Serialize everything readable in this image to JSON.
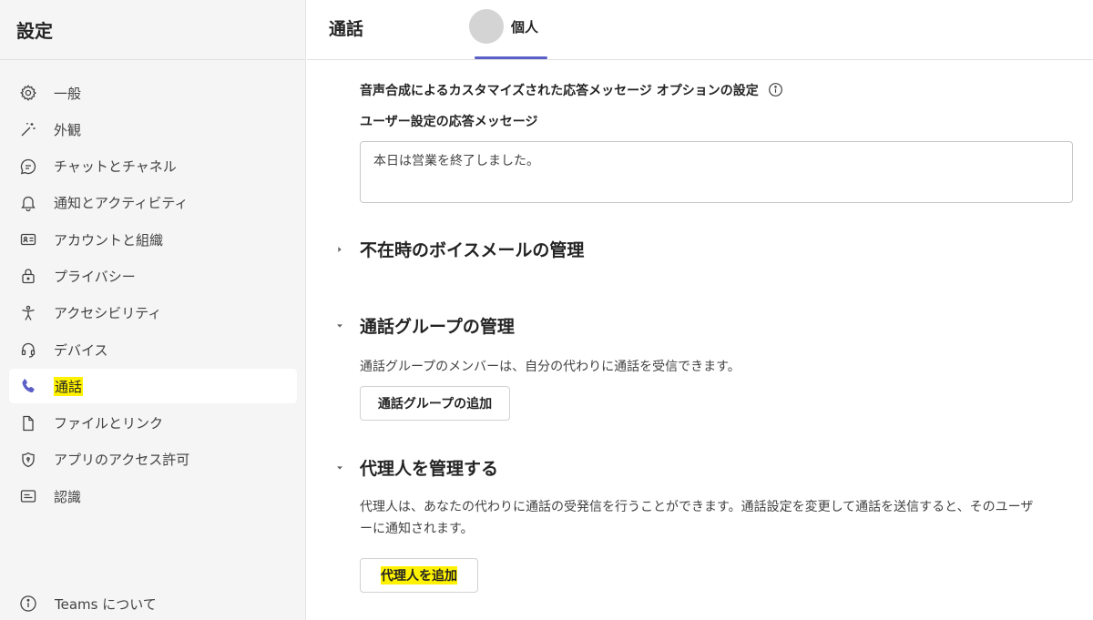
{
  "sidebar": {
    "title": "設定",
    "items": [
      {
        "label": "一般",
        "icon": "gear-icon"
      },
      {
        "label": "外観",
        "icon": "magic-wand-icon"
      },
      {
        "label": "チャットとチャネル",
        "icon": "chat-icon"
      },
      {
        "label": "通知とアクティビティ",
        "icon": "bell-icon"
      },
      {
        "label": "アカウントと組織",
        "icon": "id-card-icon"
      },
      {
        "label": "プライバシー",
        "icon": "lock-icon"
      },
      {
        "label": "アクセシビリティ",
        "icon": "accessibility-icon"
      },
      {
        "label": "デバイス",
        "icon": "headset-icon"
      },
      {
        "label": "通話",
        "icon": "phone-icon",
        "active": true
      },
      {
        "label": "ファイルとリンク",
        "icon": "document-icon"
      },
      {
        "label": "アプリのアクセス許可",
        "icon": "shield-icon"
      },
      {
        "label": "認識",
        "icon": "captions-icon"
      }
    ],
    "about_label": "Teams について"
  },
  "header": {
    "tab_calls": "通話",
    "tab_personal": "個人"
  },
  "main": {
    "tts_option_title": "音声合成によるカスタマイズされた応答メッセージ オプションの設定",
    "user_reply_label": "ユーザー設定の応答メッセージ",
    "user_reply_value": "本日は営業を終了しました。",
    "voicemail_title": "不在時のボイスメールの管理",
    "call_group_title": "通話グループの管理",
    "call_group_desc": "通話グループのメンバーは、自分の代わりに通話を受信できます。",
    "call_group_button": "通話グループの追加",
    "delegate_title": "代理人を管理する",
    "delegate_desc_line1": "代理人は、あなたの代わりに通話の受発信を行うことができます。通話設定を変更して通話を送信すると、そのユーザ",
    "delegate_desc_line2": "ーに通知されます。",
    "delegate_button": "代理人を追加"
  },
  "colors": {
    "accent": "#5b5fc7",
    "highlight": "#fff200",
    "sidebar_bg": "#f5f5f5"
  }
}
